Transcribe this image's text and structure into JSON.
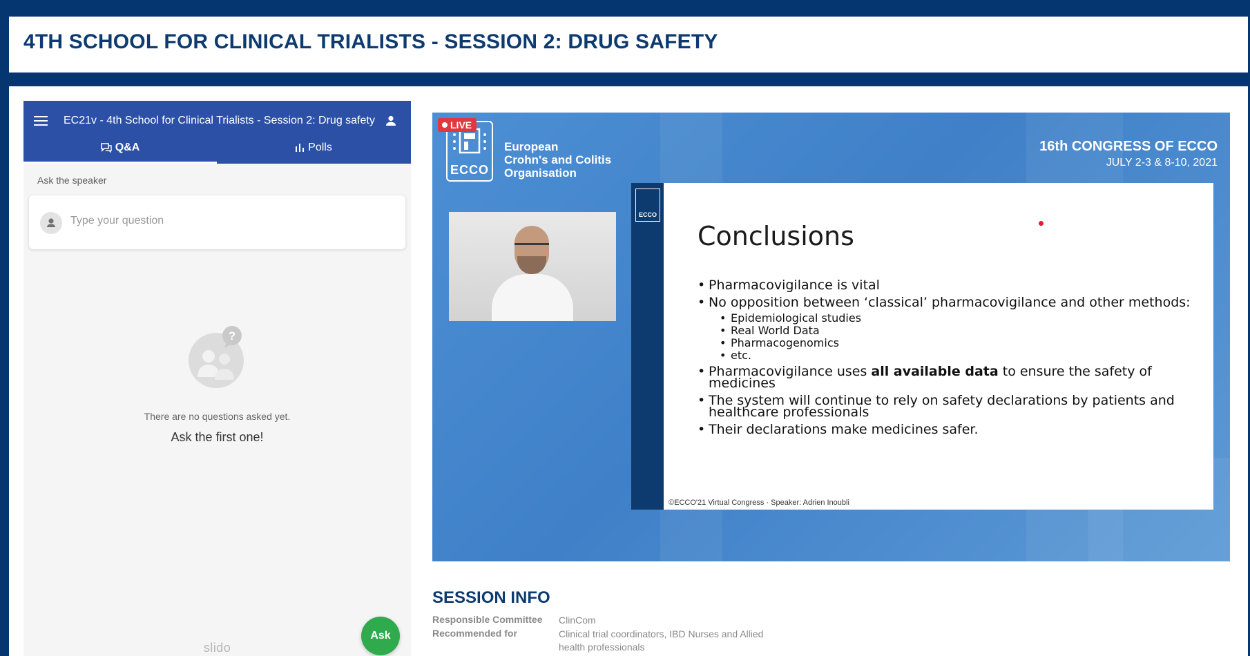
{
  "page": {
    "title": "4TH SCHOOL FOR CLINICAL TRIALISTS - SESSION 2: DRUG SAFETY"
  },
  "slido": {
    "event_title": "EC21v - 4th School for Clinical Trialists - Session 2: Drug safety",
    "tabs": [
      {
        "label": "Q&A",
        "active": true
      },
      {
        "label": "Polls",
        "active": false
      }
    ],
    "ask_label": "Ask the speaker",
    "question_placeholder": "Type your question",
    "empty_message": "There are no questions asked yet.",
    "empty_cta": "Ask the first one!",
    "ask_button": "Ask",
    "brand": "slido",
    "accent_color": "#2b50a6",
    "ask_color": "#2faa4c"
  },
  "video": {
    "live_label": "LIVE",
    "org_logo_text": "ECCO",
    "org_name": [
      "European",
      "Crohn's and Colitis",
      "Organisation"
    ],
    "congress_title": "16th CONGRESS OF ECCO",
    "congress_dates": "JULY 2-3 & 8-10, 2021",
    "slide": {
      "logo_text": "ECCO",
      "title": "Conclusions",
      "bullets": [
        "Pharmacovigilance is vital",
        "No opposition between ‘classical’ pharmacovigilance and other methods:"
      ],
      "sub_bullets": [
        "Epidemiological studies",
        "Real World Data",
        "Pharmacogenomics",
        "etc."
      ],
      "bullet_data_pre": "Pharmacovigilance uses ",
      "bullet_data_bold": "all available data",
      "bullet_data_post": " to ensure the safety of medicines",
      "bullets_after": [
        "The system will continue to rely on safety declarations by patients and healthcare professionals",
        "Their declarations make medicines safer."
      ],
      "footer": "©ECCO'21 Virtual Congress ·  Speaker: Adrien Inoubli"
    }
  },
  "session_info": {
    "heading": "SESSION INFO",
    "rows": [
      {
        "key": "Responsible Committee",
        "value": "ClinCom"
      },
      {
        "key": "Recommended for",
        "value": "Clinical trial coordinators, IBD Nurses and Allied health professionals"
      }
    ]
  }
}
